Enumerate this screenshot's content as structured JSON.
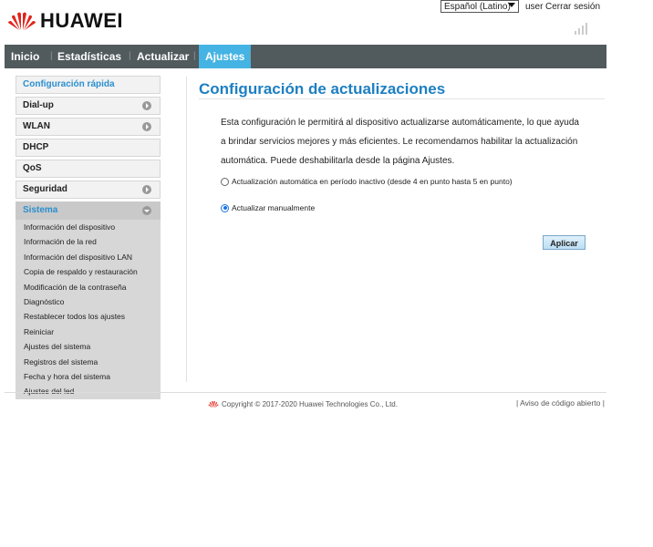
{
  "header": {
    "brand": "HUAWEI",
    "language": "Español (Latino)",
    "user": "user",
    "logout": "Cerrar sesión"
  },
  "nav": {
    "items": [
      "Inicio",
      "Estadísticas",
      "Actualizar",
      "Ajustes"
    ],
    "active": "Ajustes"
  },
  "sidebar": {
    "quick": "Configuración rápida",
    "items": [
      {
        "label": "Dial-up",
        "arrow": true
      },
      {
        "label": "WLAN",
        "arrow": true
      },
      {
        "label": "DHCP",
        "arrow": false
      },
      {
        "label": "QoS",
        "arrow": false
      },
      {
        "label": "Seguridad",
        "arrow": true
      },
      {
        "label": "Sistema",
        "arrow": true
      }
    ],
    "submenu": [
      "Información del dispositivo",
      "Información de la red",
      "Información del dispositivo LAN",
      "Copia de respaldo y restauración",
      "Modificación de la contraseña",
      "Diagnóstico",
      "Restablecer todos los ajustes",
      "Reiniciar",
      "Ajustes del sistema",
      "Registros del sistema",
      "Fecha y hora del sistema",
      "Ajustes del led"
    ]
  },
  "main": {
    "title": "Configuración de actualizaciones",
    "description": "Esta configuración le permitirá al dispositivo actualizarse automáticamente, lo que ayuda a brindar servicios mejores y más eficientes. Le recomendamos habilitar la actualización automática. Puede deshabilitarla desde la página Ajustes.",
    "option_auto": "Actualización automática en período inactivo (desde 4 en punto hasta 5 en punto)",
    "option_manual": "Actualizar manualmente",
    "selected": "manual",
    "apply": "Aplicar"
  },
  "footer": {
    "copyright": "Copyright © 2017-2020 Huawei Technologies Co., Ltd.",
    "open_source": "Aviso de código abierto"
  },
  "colors": {
    "accent": "#45b3e3",
    "nav_bg": "#515a5d",
    "title": "#1d7fc2",
    "brand_red": "#e1251b"
  }
}
